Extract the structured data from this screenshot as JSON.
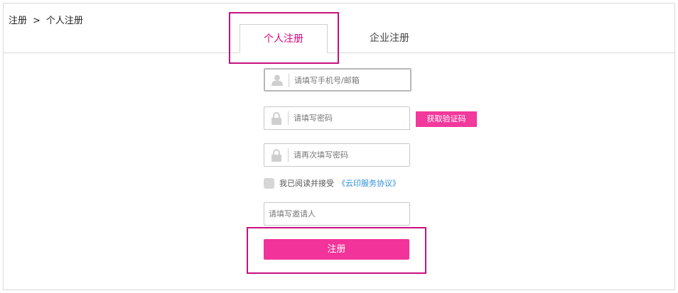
{
  "breadcrumb": {
    "root": "注册",
    "separator": ">",
    "current": "个人注册"
  },
  "tabs": [
    {
      "label": "个人注册",
      "active": true
    },
    {
      "label": "企业注册",
      "active": false
    }
  ],
  "form": {
    "account_placeholder": "请填写手机号/邮箱",
    "password_placeholder": "请填写密码",
    "confirm_placeholder": "请再次填写密码",
    "get_code_label": "获取验证码",
    "agree_text": "我已阅读并接受",
    "agreement_link": "《云印服务协议》",
    "invite_placeholder": "请填写邀请人",
    "submit_label": "注册"
  },
  "icons": {
    "account": "user-icon",
    "password": "lock-icon",
    "confirm": "lock-icon"
  },
  "colors": {
    "accent": "#e6007e",
    "button": "#f2339a",
    "link": "#2b8fd6",
    "highlight": "#c8107f"
  }
}
